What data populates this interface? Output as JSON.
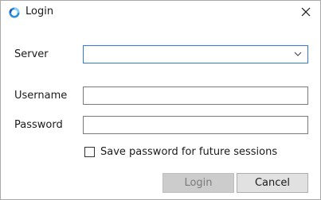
{
  "window": {
    "title": "Login",
    "icon": "app-refresh-icon",
    "close_icon": "close-icon"
  },
  "form": {
    "server_label": "Server",
    "server_value": "",
    "username_label": "Username",
    "username_value": "",
    "password_label": "Password",
    "password_value": "",
    "save_password_label": "Save password for future sessions",
    "save_password_checked": false
  },
  "buttons": {
    "login_label": "Login",
    "cancel_label": "Cancel"
  },
  "colors": {
    "accent": "#2f7ad6",
    "disabled_button_bg": "#cccccc",
    "disabled_button_text": "#7a7a7a",
    "button_bg": "#e1e1e1"
  }
}
